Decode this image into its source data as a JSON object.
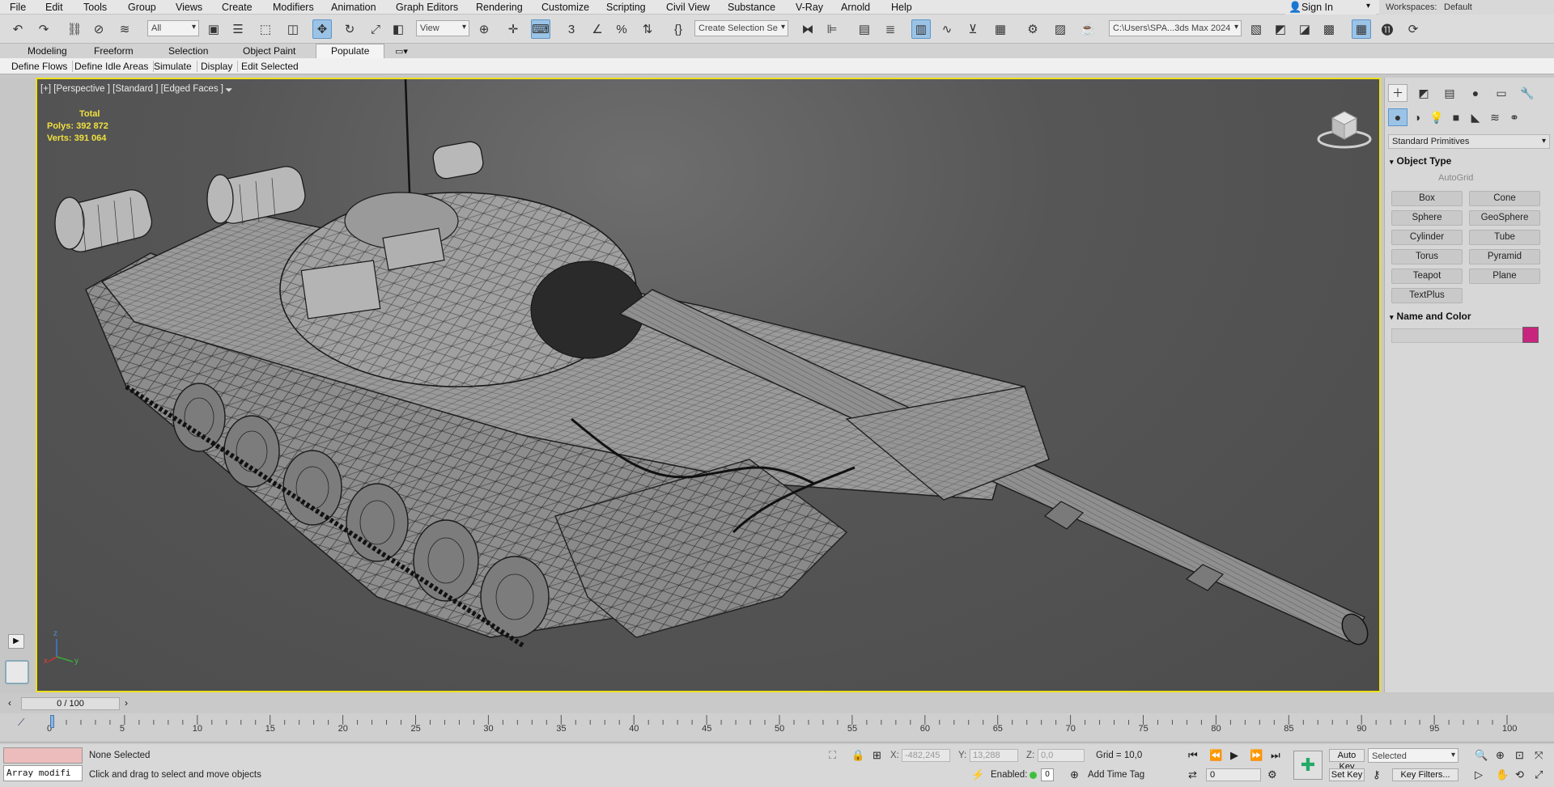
{
  "menu": {
    "items": [
      "File",
      "Edit",
      "Tools",
      "Group",
      "Views",
      "Create",
      "Modifiers",
      "Animation",
      "Graph Editors",
      "Rendering",
      "Customize",
      "Scripting",
      "Civil View",
      "Substance",
      "V-Ray",
      "Arnold",
      "Help"
    ],
    "sign_in": "Sign In",
    "workspaces_label": "Workspaces:",
    "workspace_value": "Default"
  },
  "toolbar": {
    "selection_filter": "All",
    "reference_coord": "View",
    "selection_set": "Create Selection Se",
    "project_path": "C:\\Users\\SPA...3ds Max 2024"
  },
  "ribbon": {
    "tabs": [
      "Modeling",
      "Freeform",
      "Selection",
      "Object Paint",
      "Populate"
    ],
    "active_tab": "Populate",
    "sub_items": [
      "Define Flows",
      "Define Idle Areas",
      "Simulate",
      "Display",
      "Edit Selected"
    ]
  },
  "viewport": {
    "label": "[+] [Perspective ] [Standard ] [Edged Faces ]",
    "stats_title": "Total",
    "polys_label": "Polys:",
    "polys_value": "392 872",
    "verts_label": "Verts:",
    "verts_value": "391 064",
    "axis_x": "x",
    "axis_y": "y",
    "axis_z": "z"
  },
  "command_panel": {
    "category": "Standard Primitives",
    "object_type_title": "Object Type",
    "autogrid_label": "AutoGrid",
    "buttons": [
      "Box",
      "Cone",
      "Sphere",
      "GeoSphere",
      "Cylinder",
      "Tube",
      "Torus",
      "Pyramid",
      "Teapot",
      "Plane",
      "TextPlus"
    ],
    "name_color_title": "Name and Color",
    "object_color": "#c8267e"
  },
  "timeline": {
    "frame_display": "0 / 100",
    "ticks": [
      "0",
      "5",
      "10",
      "15",
      "20",
      "25",
      "30",
      "35",
      "40",
      "45",
      "50",
      "55",
      "60",
      "65",
      "70",
      "75",
      "80",
      "85",
      "90",
      "95",
      "100"
    ]
  },
  "status": {
    "script_listener": "Array modifi",
    "selection_status": "None Selected",
    "prompt": "Click and drag to select and move objects",
    "x_label": "X:",
    "x_value": "-482,245",
    "y_label": "Y:",
    "y_value": "13,288",
    "z_label": "Z:",
    "z_value": "0,0",
    "grid": "Grid = 10,0",
    "enabled_label": "Enabled:",
    "enabled_value": "0",
    "add_time_tag": "Add Time Tag",
    "auto_key": "Auto Key",
    "set_key": "Set Key",
    "selected_dd": "Selected",
    "key_filters": "Key Filters...",
    "current_frame": "0"
  }
}
